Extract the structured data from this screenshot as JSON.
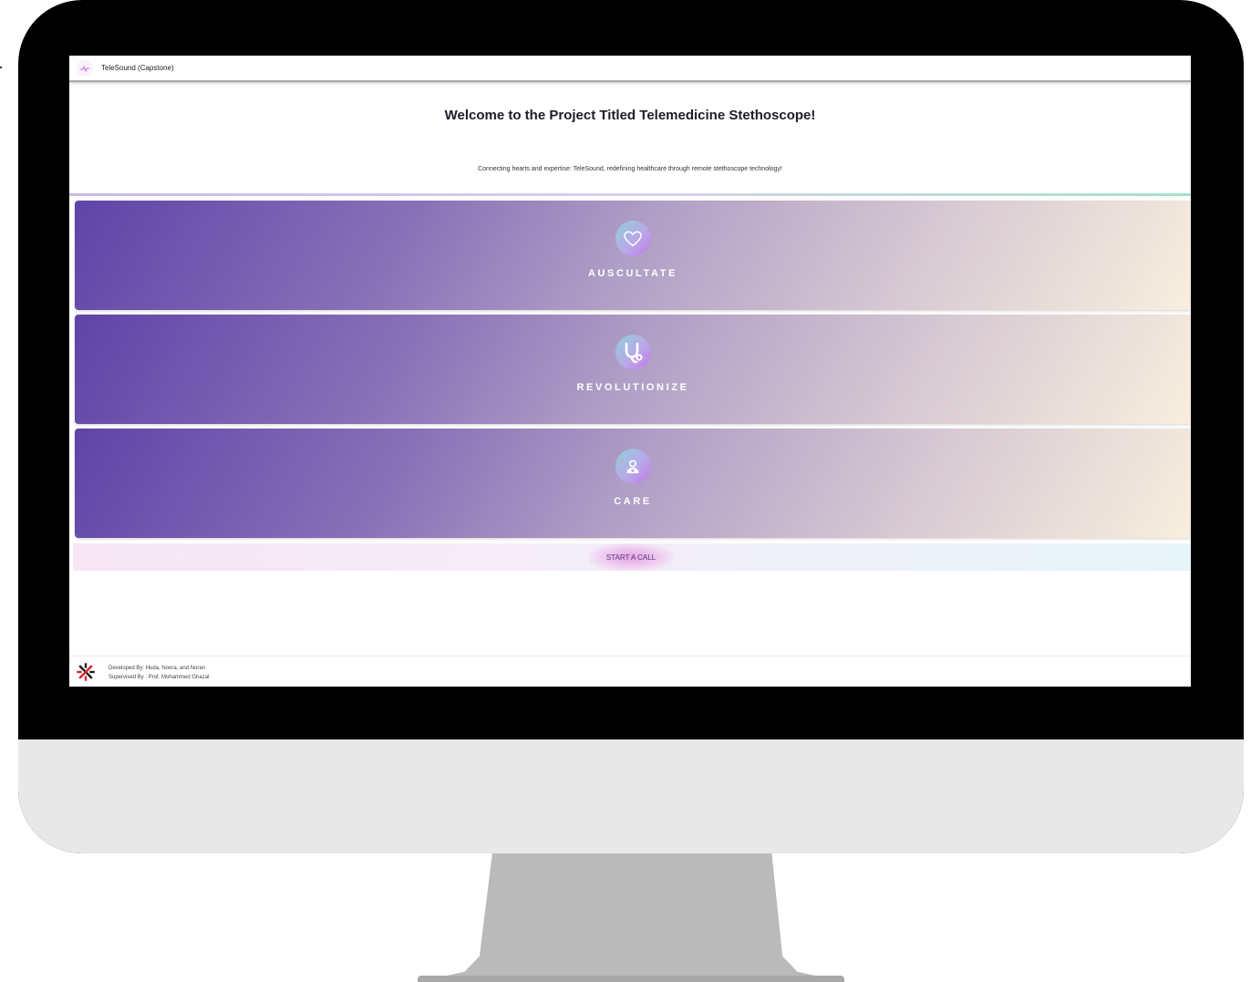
{
  "app": {
    "title": "TeleSound (Capstone)"
  },
  "main": {
    "heading": "Welcome to the Project Titled Telemedicine Stethoscope!",
    "tagline": "Connecting hearts and expertise: TeleSound, redefining healthcare through remote stethoscope technology!"
  },
  "cards": [
    {
      "label": "AUSCULTATE",
      "icon": "heart-icon"
    },
    {
      "label": "REVOLUTIONIZE",
      "icon": "stethoscope-icon"
    },
    {
      "label": "CARE",
      "icon": "doctor-icon"
    }
  ],
  "actions": {
    "start_call": "START A CALL"
  },
  "footer": {
    "developed_by": "Developed By: Huda, Noora, and Noran",
    "supervised_by": "Supervised By : Prof. Mohammed Ghazal"
  },
  "colors": {
    "monitor_bezel": "#000000",
    "monitor_chin": "#e8e8e8",
    "stand": "#bababa",
    "card_gradient_start": "#5f44a8",
    "card_gradient_end": "#f8efde",
    "icon_gradient_start": "#8fd0d9",
    "icon_gradient_end": "#c07ae6",
    "footer_logo_red": "#d8232a"
  }
}
